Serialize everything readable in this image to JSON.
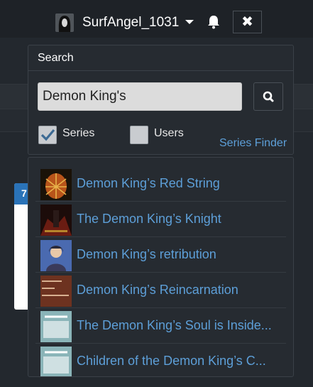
{
  "header": {
    "username": "SurfAngel_1031",
    "avatar_icon": "avatar-icon",
    "close_label": "✖"
  },
  "background": {
    "card_number": "7"
  },
  "search": {
    "title": "Search",
    "query": "Demon King's",
    "series_label": "Series",
    "series_checked": true,
    "users_label": "Users",
    "users_checked": false,
    "series_finder": "Series Finder",
    "accent": "#5d9fd8"
  },
  "results": [
    {
      "title": "Demon King’s Red String"
    },
    {
      "title": "The Demon King’s Knight"
    },
    {
      "title": "Demon King’s retribution"
    },
    {
      "title": "Demon King’s Reincarnation"
    },
    {
      "title": "The Demon King’s Soul is Inside..."
    },
    {
      "title": "Children of the Demon King’s C..."
    }
  ]
}
